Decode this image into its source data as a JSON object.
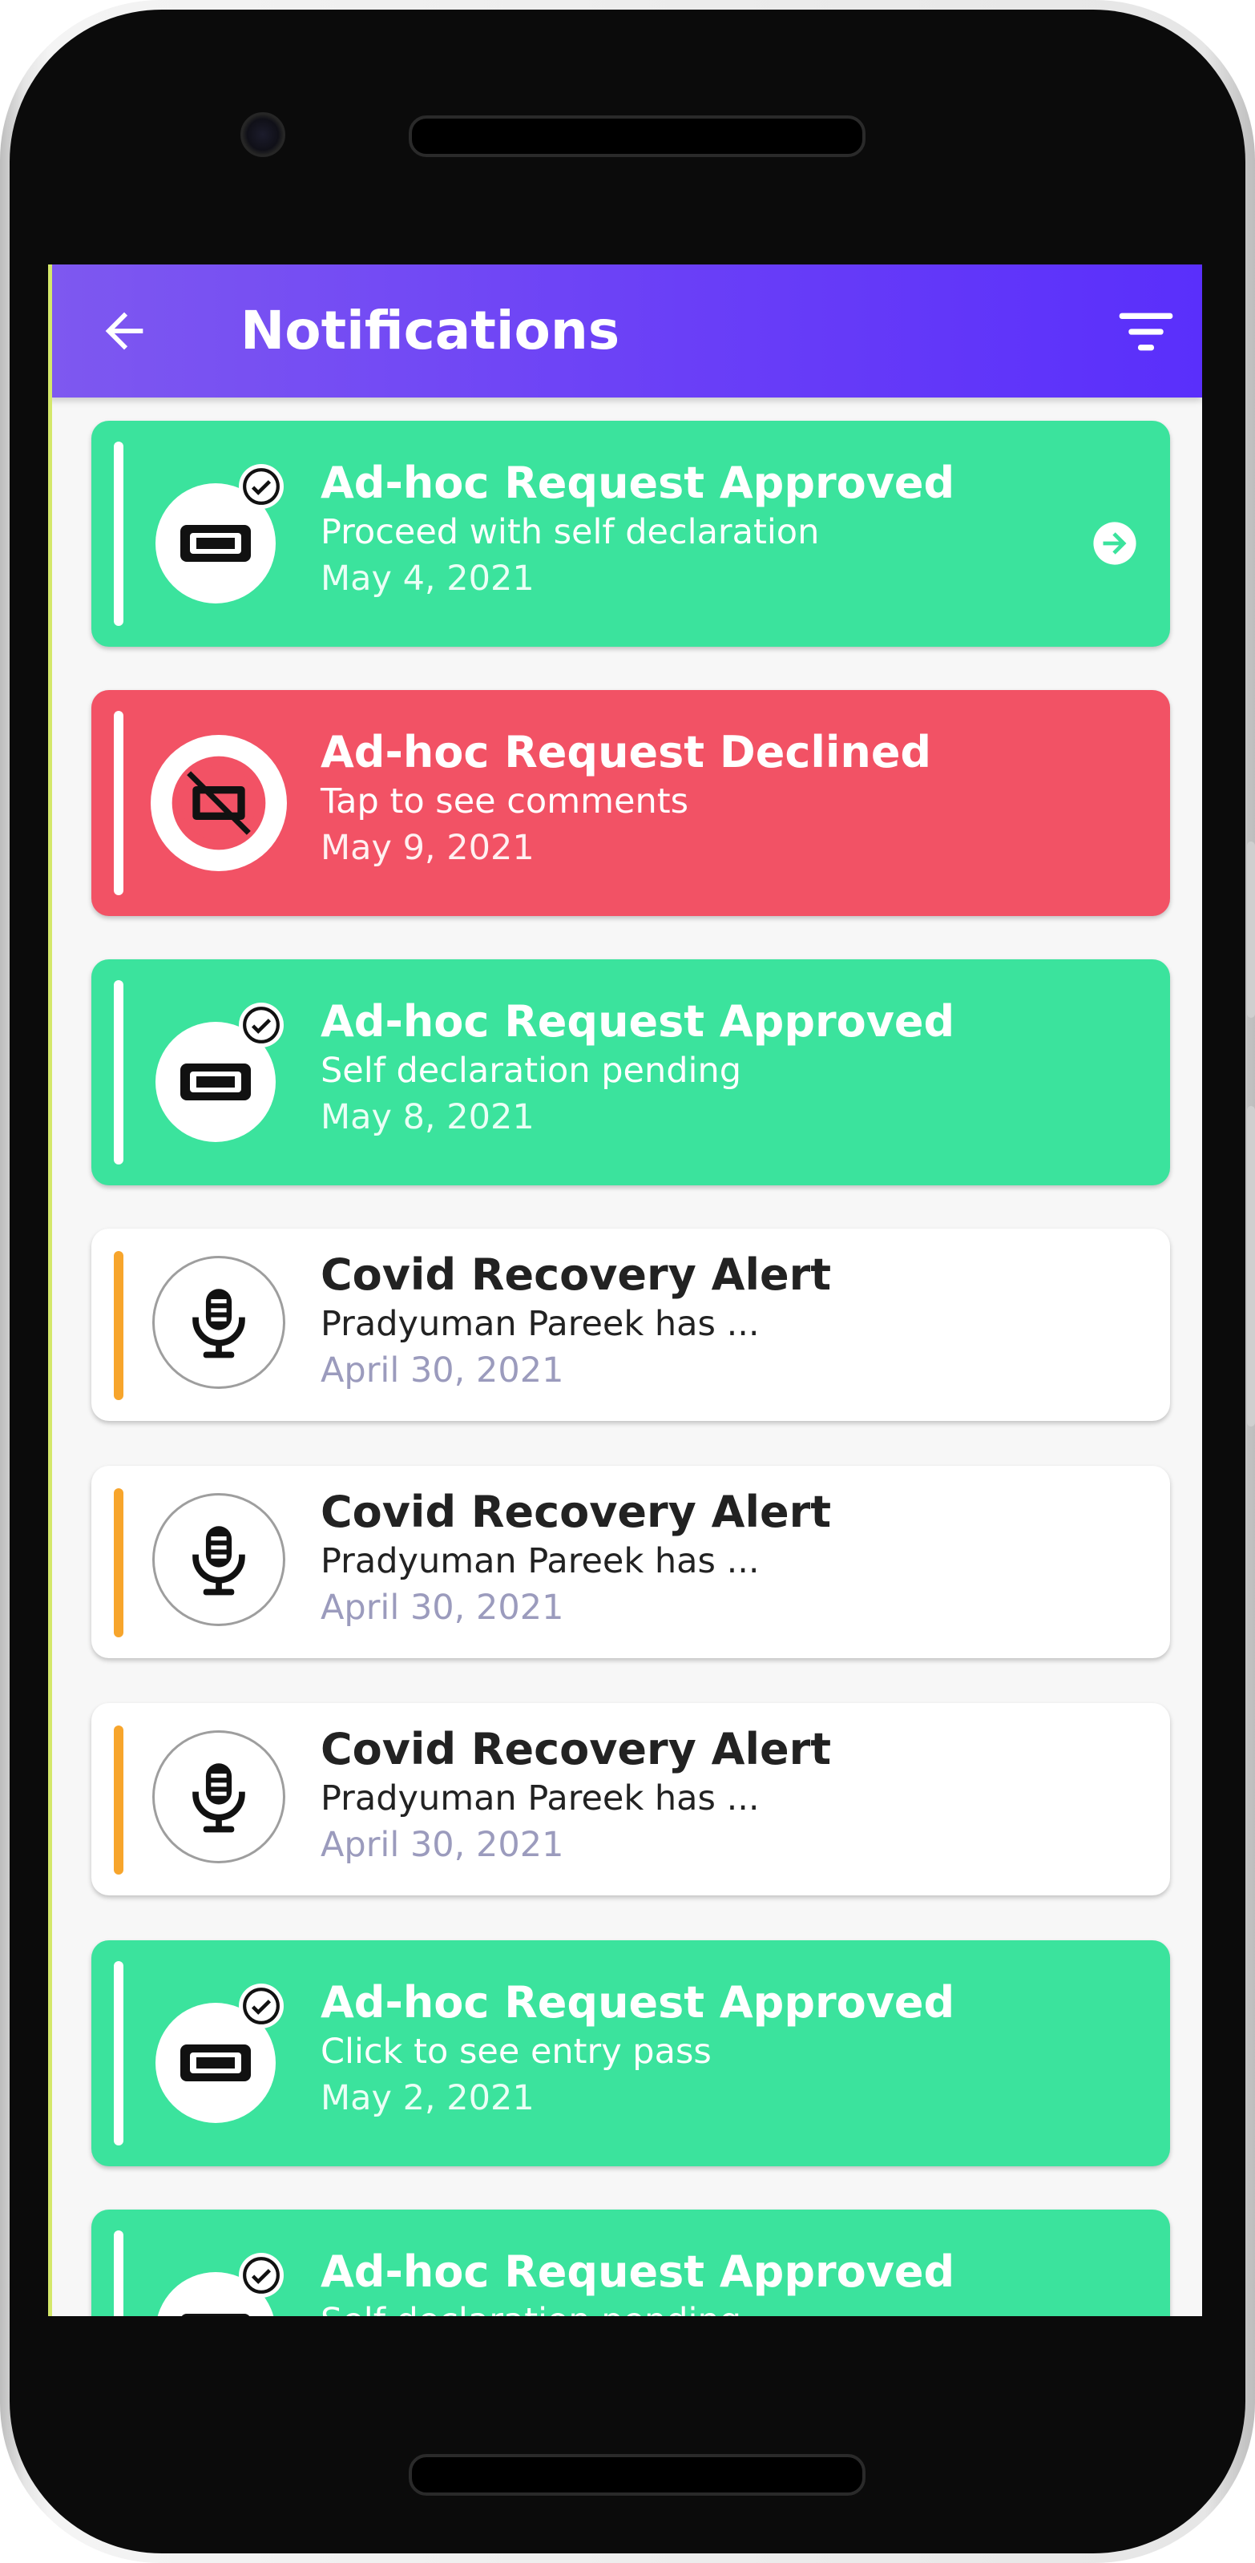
{
  "app": {
    "title": "Notifications",
    "accent_color": "#6a3ff7",
    "back_icon": "arrow-left-icon",
    "filter_icon": "filter-icon"
  },
  "colors": {
    "approved": "#3be39d",
    "declined": "#f25265",
    "alert": "#ffffff",
    "alert_stripe": "#f7a52c"
  },
  "notifications": [
    {
      "type": "approved",
      "icon": "ticket-check-icon",
      "title": "Ad-hoc Request Approved",
      "subtitle": "Proceed with self declaration",
      "date": "May 4, 2021",
      "action_icon": "arrow-right-circle-icon"
    },
    {
      "type": "declined",
      "icon": "ticket-blocked-icon",
      "title": "Ad-hoc Request Declined",
      "subtitle": "Tap to see comments",
      "date": "May 9, 2021"
    },
    {
      "type": "approved",
      "icon": "ticket-check-icon",
      "title": "Ad-hoc Request Approved",
      "subtitle": "Self declaration pending",
      "date": "May 8, 2021"
    },
    {
      "type": "alert",
      "icon": "microphone-icon",
      "title": "Covid Recovery Alert",
      "subtitle": "Pradyuman Pareek has ...",
      "date": "April 30, 2021"
    },
    {
      "type": "alert",
      "icon": "microphone-icon",
      "title": "Covid Recovery Alert",
      "subtitle": "Pradyuman Pareek has ...",
      "date": "April 30, 2021"
    },
    {
      "type": "alert",
      "icon": "microphone-icon",
      "title": "Covid Recovery Alert",
      "subtitle": "Pradyuman Pareek has ...",
      "date": "April 30, 2021"
    },
    {
      "type": "approved",
      "icon": "ticket-check-icon",
      "title": "Ad-hoc Request Approved",
      "subtitle": "Click to see entry pass",
      "date": "May 2, 2021"
    },
    {
      "type": "approved",
      "icon": "ticket-check-icon",
      "title": "Ad-hoc Request Approved",
      "subtitle": "Self declaration pending",
      "date": ""
    }
  ]
}
